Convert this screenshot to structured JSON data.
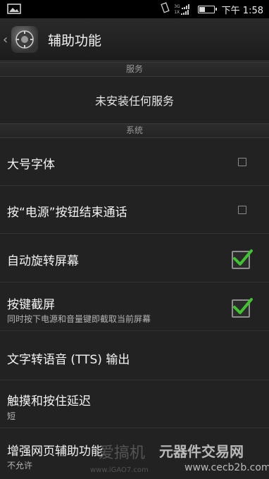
{
  "status": {
    "net1": "3G",
    "net2": "1X",
    "time": "下午 1:58",
    "battery_level": 0.45
  },
  "header": {
    "title": "辅助功能"
  },
  "sections": {
    "services": "服务",
    "system": "系统"
  },
  "services_empty": "未安装任何服务",
  "items": [
    {
      "title": "大号字体",
      "checked": false
    },
    {
      "title": "按“电源”按钮结束通话",
      "checked": false
    },
    {
      "title": "自动旋转屏幕",
      "checked": true
    },
    {
      "title": "按键截屏",
      "subtitle": "同时按下电源和音量键即截取当前屏幕",
      "checked": true
    },
    {
      "title": "文字转语音 (TTS) 输出"
    },
    {
      "title": "触摸和按住延迟",
      "subtitle": "短"
    },
    {
      "title": "增强网页辅助功能",
      "subtitle": "不允许"
    }
  ],
  "colors": {
    "check_green": "#3fc430"
  }
}
